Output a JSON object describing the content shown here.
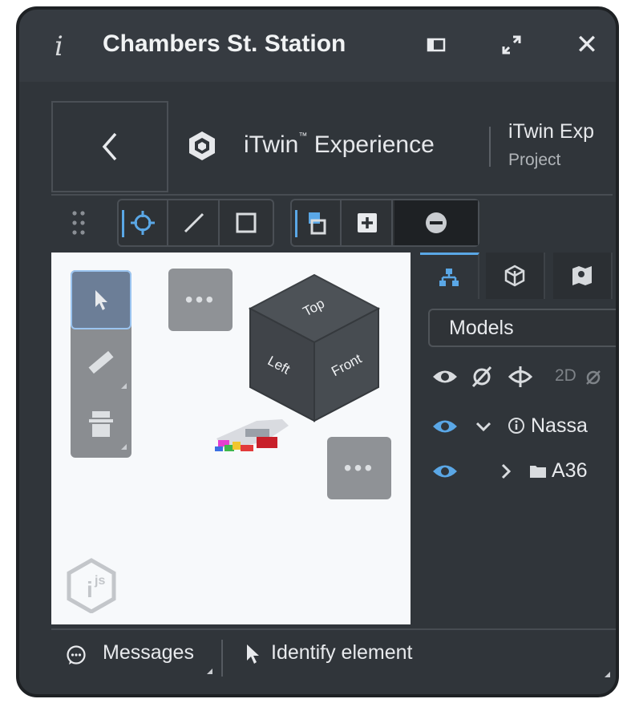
{
  "window": {
    "title": "Chambers St. Station",
    "info_icon": "info-icon",
    "dock_icon": "dock-panel-icon",
    "expand_icon": "expand-icon",
    "close_icon": "close-icon"
  },
  "header": {
    "back_icon": "chevron-left-icon",
    "brand_name": "iTwin",
    "brand_suffix": " Experience",
    "brand_mark": "™",
    "project_title": "iTwin Exp",
    "project_type": "Project"
  },
  "toolbar": {
    "groups": [
      {
        "name": "section-tools",
        "buttons": [
          "section-by-point-icon",
          "section-by-plane-icon",
          "section-by-element-icon"
        ]
      },
      {
        "name": "view-clip-tools",
        "buttons": [
          "clip-shape-icon",
          "add-clip-icon",
          "remove-clip-icon"
        ]
      }
    ]
  },
  "viewport": {
    "navigation_cube": {
      "top": "Top",
      "left": "Left",
      "front": "Front"
    },
    "more_buttons": [
      "more-options-icon",
      "more-options-icon"
    ],
    "tools": [
      "select-icon",
      "measure-icon",
      "section-icon"
    ],
    "logo": "itwinjs-logo"
  },
  "side_panel": {
    "tabs": [
      "models-tree-icon",
      "categories-icon",
      "spatial-icon"
    ],
    "selector_value": "Models",
    "visibility_controls": {
      "show_all": "eye-icon",
      "hide_all": "eye-slash-icon",
      "invert": "invert-visibility-icon",
      "view_2d": "2D"
    },
    "tree": [
      {
        "label": "Nassa",
        "expanded": true,
        "icon": "info-circle-icon"
      },
      {
        "label": "A36",
        "expanded": false,
        "icon": "folder-icon"
      }
    ]
  },
  "status_bar": {
    "messages_label": "Messages",
    "identify_label": "Identify element"
  },
  "colors": {
    "accent": "#5aa7e6",
    "panel_bg": "#30353a",
    "title_bg": "#363b41"
  }
}
